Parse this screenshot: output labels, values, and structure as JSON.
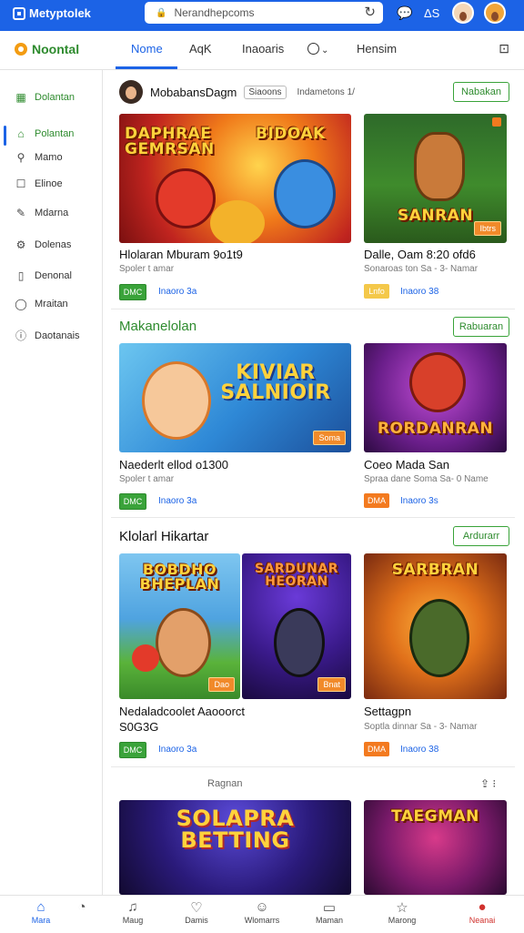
{
  "browser": {
    "brand": "Metyptolek",
    "url": "Nerandhepcoms",
    "lock_icon": "lock-icon",
    "reload_icon": "reload-icon",
    "status_text": "ΔS"
  },
  "appnav": {
    "logo": "Noontal",
    "tabs": [
      {
        "label": "Nome",
        "active": true
      },
      {
        "label": "AqK"
      },
      {
        "label": "Inaoaris"
      },
      {
        "label": "O"
      },
      {
        "label": "Hensim"
      }
    ]
  },
  "sidebar": {
    "items": [
      {
        "label": "Dolantan",
        "icon": "grid-icon"
      },
      {
        "label": "Polantan",
        "icon": "home-icon",
        "active": true
      },
      {
        "label": "Mamo",
        "icon": "search-icon"
      },
      {
        "label": "Elinoe",
        "icon": "box-icon"
      },
      {
        "label": "Mdarna",
        "icon": "pen-icon"
      },
      {
        "label": "Dolenas",
        "icon": "settings-icon"
      },
      {
        "label": "Denonal",
        "icon": "mobile-icon"
      },
      {
        "label": "Mraitan",
        "icon": "shield-icon"
      },
      {
        "label": "Daotanais",
        "icon": "info-icon"
      }
    ]
  },
  "user_row": {
    "name": "MobabansDagm",
    "chip": "Siaoons",
    "meta": "Indametons 1/",
    "button": "Nabakan"
  },
  "sections": [
    {
      "title": "",
      "cards": [
        {
          "thumb_title": "DAPHRAE GEMRSAN",
          "thumb_title2": "BIDOAK",
          "title": "Hlolaran Mburam 9o1t9",
          "sub": "Spoler t amar",
          "tag": "DMC",
          "link": "Inaoro 3a"
        },
        {
          "thumb_title": "SANRAN",
          "badge": "Ibtrs",
          "title": "Dalle, Oam 8:20 ofd6",
          "sub": "Sonaroas ton Sa - 3- Namar",
          "tag": "Lnfo",
          "link": "Inaoro 38"
        }
      ]
    },
    {
      "title": "Makanelolan",
      "button": "Rabuaran",
      "cards": [
        {
          "thumb_title": "KIVIAR SALNIOIR",
          "badge": "Soma",
          "title": "Naederlt ellod o1300",
          "sub": "Spoler t amar",
          "tag": "DMC",
          "link": "Inaoro 3a"
        },
        {
          "thumb_title": "RORDANRAN",
          "title": "Coeo Mada San",
          "sub": "Spraa dane Soma Sa- 0 Name",
          "tag": "DMA",
          "link": "Inaoro 3s"
        }
      ]
    },
    {
      "title": "Klolarl Hikartar",
      "button": "Ardurarr",
      "cards": [
        {
          "thumb_title": "BOBDHO BHEPLAN",
          "badge": "Dao",
          "title": "Nedaladcoolet Aaooorct",
          "title2": "S0G3G",
          "sub": "",
          "tag": "DMC",
          "link": "Inaoro 3a"
        },
        {
          "thumb_title": "SARDUNAR HEORAN",
          "badge": "Bnat",
          "title": "",
          "sub": "",
          "tag": "",
          "link": ""
        },
        {
          "thumb_title": "SARBRAN",
          "title": "Settagpn",
          "sub": "Soptla dinnar Sa - 3- Namar",
          "tag": "DMA",
          "link": "Inaoro 38"
        }
      ]
    },
    {
      "label": "Ragnan",
      "cards": [
        {
          "thumb_title": "SOLAPRA BETTING"
        },
        {
          "thumb_title": "TAEGMAN"
        }
      ]
    }
  ],
  "tabbar": [
    {
      "label": "Mara",
      "icon": "home-icon",
      "active": true
    },
    {
      "label": "",
      "icon": "clock-icon"
    },
    {
      "label": "Maug",
      "icon": "bell-icon"
    },
    {
      "label": "Damis",
      "icon": "heart-icon"
    },
    {
      "label": "Wlomarrs",
      "icon": "smile-icon"
    },
    {
      "label": "Maman",
      "icon": "doc-icon"
    },
    {
      "label": "Marong",
      "icon": "star-icon"
    },
    {
      "label": "Neanai",
      "icon": "user-icon",
      "highlight": true
    }
  ]
}
